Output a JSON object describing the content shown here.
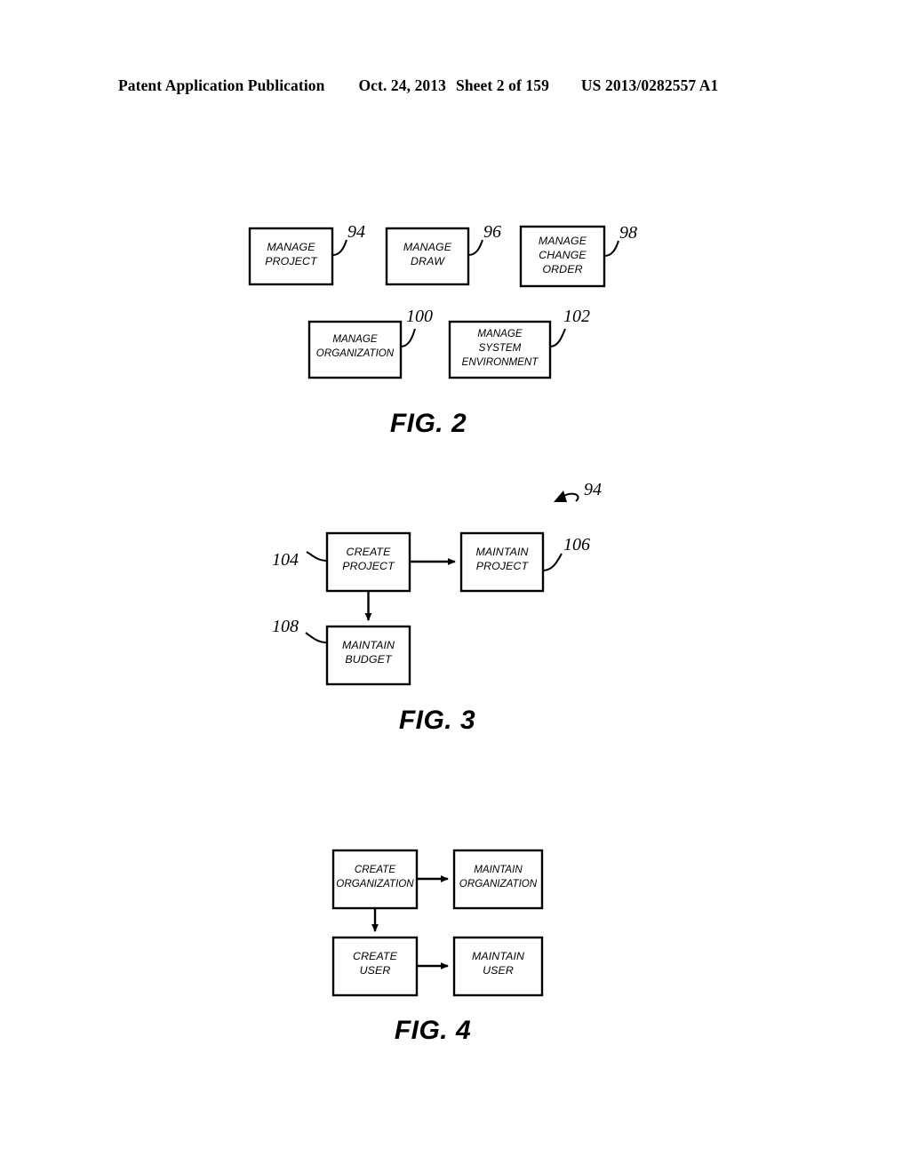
{
  "header": {
    "publication": "Patent Application Publication",
    "date": "Oct. 24, 2013",
    "sheet": "Sheet 2 of 159",
    "patent_number": "US 2013/0282557 A1"
  },
  "figures": [
    {
      "id": "fig2",
      "caption": "FIG. 2",
      "nodes": [
        {
          "id": "manage-project",
          "line1": "MANAGE",
          "line2": "PROJECT",
          "line3": "",
          "ref": "94"
        },
        {
          "id": "manage-draw",
          "line1": "MANAGE",
          "line2": "DRAW",
          "line3": "",
          "ref": "96"
        },
        {
          "id": "manage-change-order",
          "line1": "MANAGE",
          "line2": "CHANGE",
          "line3": "ORDER",
          "ref": "98"
        },
        {
          "id": "manage-organization",
          "line1": "MANAGE",
          "line2": "ORGANIZATION",
          "line3": "",
          "ref": "100"
        },
        {
          "id": "manage-system-environment",
          "line1": "MANAGE",
          "line2": "SYSTEM",
          "line3": "ENVIRONMENT",
          "ref": "102"
        }
      ]
    },
    {
      "id": "fig3",
      "caption": "FIG. 3",
      "figure_ref": "94",
      "nodes": [
        {
          "id": "create-project",
          "line1": "CREATE",
          "line2": "PROJECT",
          "ref": "104"
        },
        {
          "id": "maintain-project",
          "line1": "MAINTAIN",
          "line2": "PROJECT",
          "ref": "106"
        },
        {
          "id": "maintain-budget",
          "line1": "MAINTAIN",
          "line2": "BUDGET",
          "ref": "108"
        }
      ]
    },
    {
      "id": "fig4",
      "caption": "FIG. 4",
      "nodes": [
        {
          "id": "create-organization",
          "line1": "CREATE",
          "line2": "ORGANIZATION",
          "ref": ""
        },
        {
          "id": "maintain-organization",
          "line1": "MAINTAIN",
          "line2": "ORGANIZATION",
          "ref": ""
        },
        {
          "id": "create-user",
          "line1": "CREATE",
          "line2": "USER",
          "ref": ""
        },
        {
          "id": "maintain-user",
          "line1": "MAINTAIN",
          "line2": "USER",
          "ref": ""
        }
      ]
    }
  ],
  "colors": {
    "ink": "#000000",
    "paper": "#ffffff"
  }
}
